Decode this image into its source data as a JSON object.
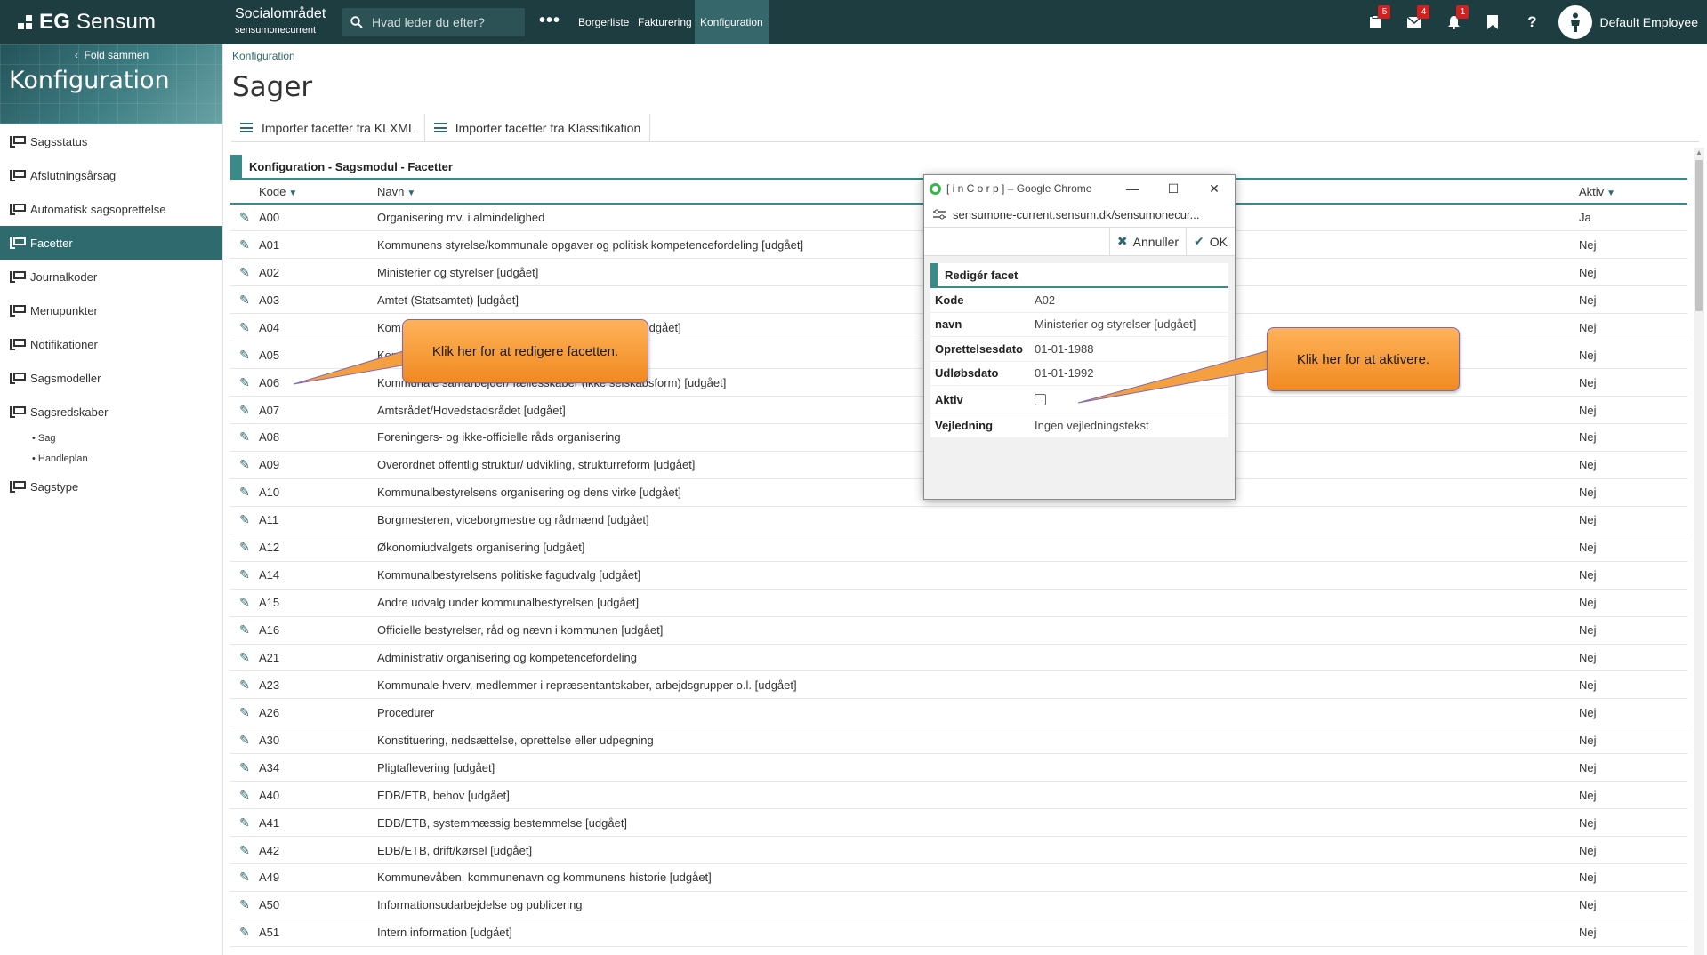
{
  "topbar": {
    "brand": "EG Sensum",
    "brand_bold": "EG",
    "brand_light": "Sensum",
    "area_title": "Socialområdet",
    "area_sub": "sensumonecurrent",
    "search_placeholder": "Hvad leder du efter?",
    "more": "•••",
    "nav": [
      "Borgerliste",
      "Fakturering",
      "Konfiguration"
    ],
    "active_nav": "Konfiguration",
    "badges": {
      "clipboard": "5",
      "mail": "4",
      "bell": "1"
    },
    "user_name": "Default Employee"
  },
  "sidebar": {
    "fold_label": "Fold sammen",
    "title": "Konfiguration",
    "items": [
      "Sagsstatus",
      "Afslutningsårsag",
      "Automatisk sagsoprettelse",
      "Facetter",
      "Journalkoder",
      "Menupunkter",
      "Notifikationer",
      "Sagsmodeller",
      "Sagsredskaber"
    ],
    "sub_items": [
      "• Sag",
      "• Handleplan"
    ],
    "last_item": "Sagstype",
    "active": "Facetter"
  },
  "main": {
    "breadcrumb": "Konfiguration",
    "title": "Sager",
    "toolbar": [
      "Importer facetter fra KLXML",
      "Importer facetter fra Klassifikation"
    ],
    "panel_title": "Konfiguration - Sagsmodul - Facetter",
    "columns": {
      "kode": "Kode",
      "navn": "Navn",
      "aktiv": "Aktiv"
    },
    "rows": [
      [
        "A00",
        "Organisering mv. i almindelighed",
        "Ja"
      ],
      [
        "A01",
        "Kommunens styrelse/kommunale opgaver og politisk kompetencefordeling [udgået]",
        "Nej"
      ],
      [
        "A02",
        "Ministerier og styrelser [udgået]",
        "Nej"
      ],
      [
        "A03",
        "Amtet (Statsamtet) [udgået]",
        "Nej"
      ],
      [
        "A04",
        "Kom",
        "Nej"
      ],
      [
        "A05",
        "Kom",
        "Nej"
      ],
      [
        "A06",
        "Kommunale samarbejder/ fællesskaber (ikke selskabsform) [udgået]",
        "Nej"
      ],
      [
        "A07",
        "Amtsrådet/Hovedstadsrådet [udgået]",
        "Nej"
      ],
      [
        "A08",
        "Foreningers- og ikke-officielle råds organisering",
        "Nej"
      ],
      [
        "A09",
        "Overordnet offentlig struktur/ udvikling, strukturreform [udgået]",
        "Nej"
      ],
      [
        "A10",
        "Kommunalbestyrelsens organisering og dens virke [udgået]",
        "Nej"
      ],
      [
        "A11",
        "Borgmesteren, viceborgmestre og rådmænd [udgået]",
        "Nej"
      ],
      [
        "A12",
        "Økonomiudvalgets organisering [udgået]",
        "Nej"
      ],
      [
        "A14",
        "Kommunalbestyrelsens politiske fagudvalg [udgået]",
        "Nej"
      ],
      [
        "A15",
        "Andre udvalg under kommunalbestyrelsen [udgået]",
        "Nej"
      ],
      [
        "A16",
        "Officielle bestyrelser, råd og nævn i kommunen [udgået]",
        "Nej"
      ],
      [
        "A21",
        "Administrativ organisering og kompetencefordeling",
        "Nej"
      ],
      [
        "A23",
        "Kommunale hverv, medlemmer i repræsentantskaber, arbejdsgrupper o.l. [udgået]",
        "Nej"
      ],
      [
        "A26",
        "Procedurer",
        "Nej"
      ],
      [
        "A30",
        "Konstituering, nedsættelse, oprettelse eller udpegning",
        "Nej"
      ],
      [
        "A34",
        "Pligtaflevering [udgået]",
        "Nej"
      ],
      [
        "A40",
        "EDB/ETB, behov [udgået]",
        "Nej"
      ],
      [
        "A41",
        "EDB/ETB, systemmæssig bestemmelse [udgået]",
        "Nej"
      ],
      [
        "A42",
        "EDB/ETB, drift/kørsel [udgået]",
        "Nej"
      ],
      [
        "A49",
        "Kommunevåben, kommunenavn og kommunens historie [udgået]",
        "Nej"
      ],
      [
        "A50",
        "Informationsudarbejdelse og publicering",
        "Nej"
      ],
      [
        "A51",
        "Intern information [udgået]",
        "Nej"
      ]
    ],
    "row04_tail": "ber mv. [udgået]"
  },
  "popup": {
    "window_title": "[ i n C o r p ] – Google Chrome",
    "url": "sensumone-current.sensum.dk/sensumonecur...",
    "cancel_label": "Annuller",
    "ok_label": "OK",
    "panel_title": "Redigér facet",
    "fields": [
      {
        "label": "Kode",
        "value": "A02"
      },
      {
        "label": "navn",
        "value": "Ministerier og styrelser [udgået]"
      },
      {
        "label": "Oprettelsesdato",
        "value": "01-01-1988"
      },
      {
        "label": "Udløbsdato",
        "value": "01-01-1992"
      },
      {
        "label": "Aktiv",
        "value": ""
      },
      {
        "label": "Vejledning",
        "value": "Ingen vejledningstekst"
      }
    ],
    "aktiv_checked": false
  },
  "callouts": {
    "edit": "Klik her for at redigere facetten.",
    "activate": "Klik her for at aktivere."
  },
  "colors": {
    "topbar": "#1e3d40",
    "accent": "#3a8a8a",
    "active_sidebar": "#2f6a6e",
    "callout": "#f08a20",
    "badge": "#d21f1f"
  }
}
